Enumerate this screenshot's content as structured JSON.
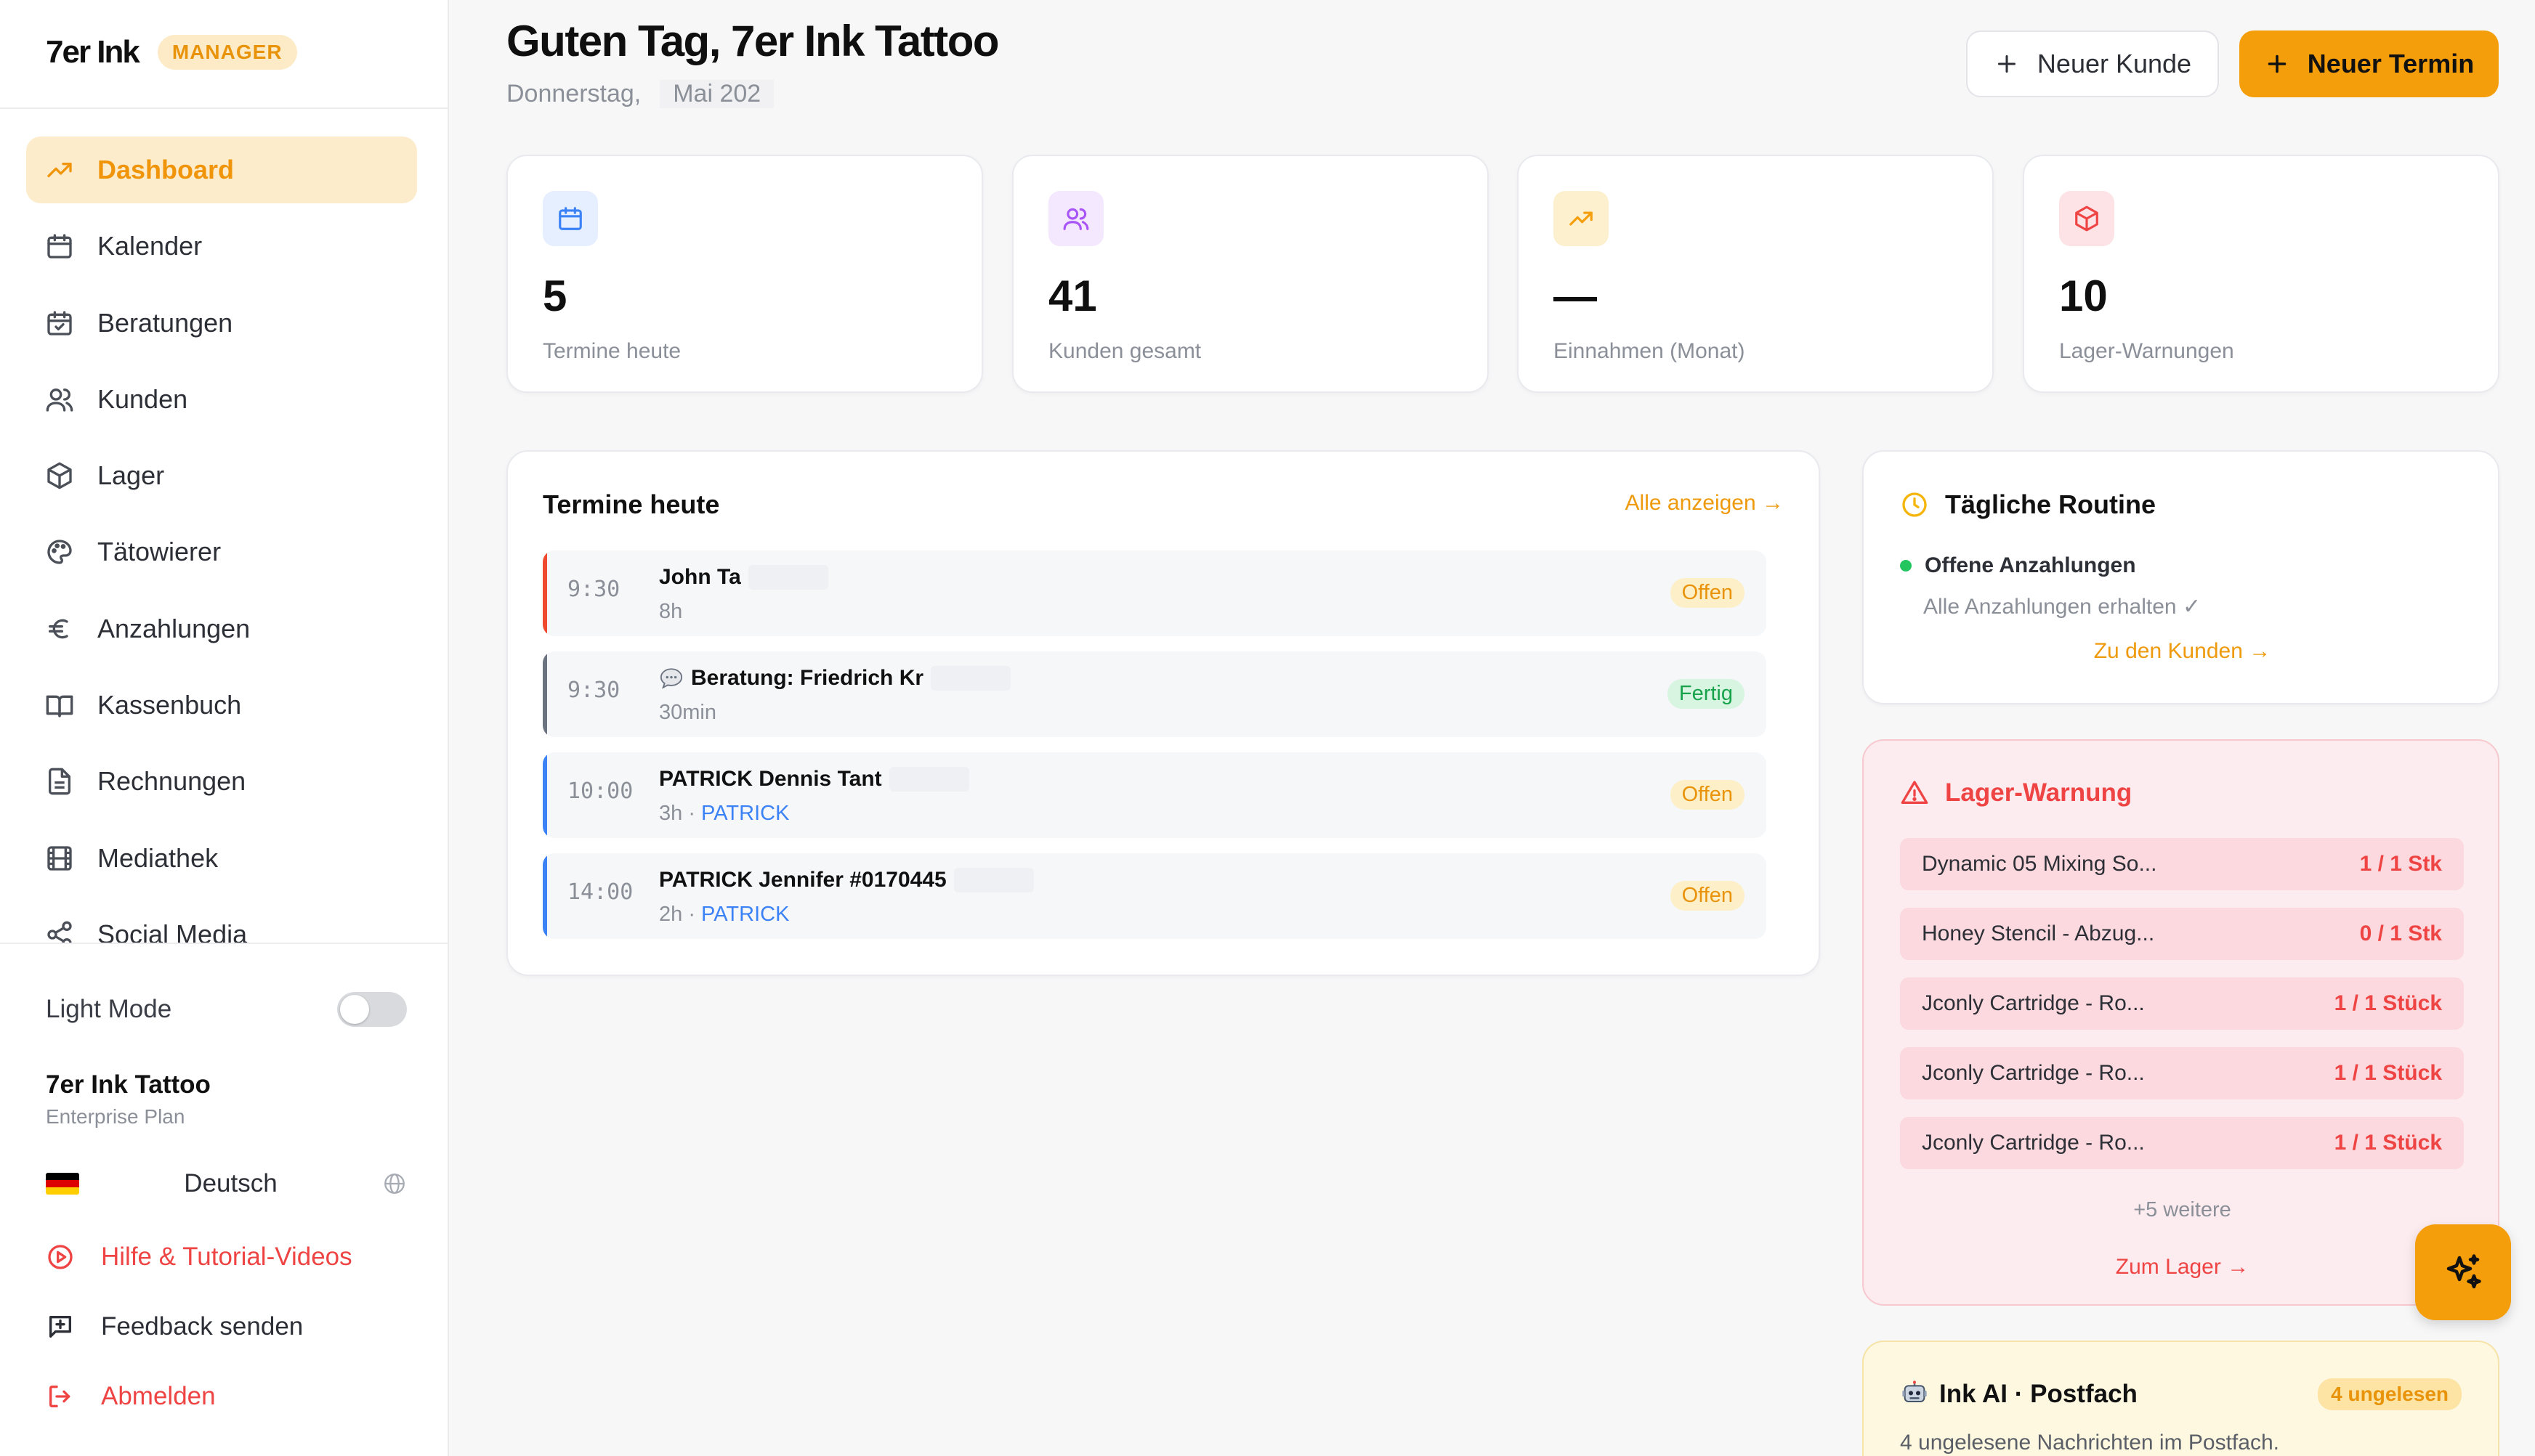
{
  "brand": {
    "name": "7er Ink",
    "role_badge": "MANAGER"
  },
  "sidebar": {
    "items": [
      {
        "label": "Dashboard",
        "icon": "trending-up-icon",
        "active": true
      },
      {
        "label": "Kalender",
        "icon": "calendar-icon"
      },
      {
        "label": "Beratungen",
        "icon": "calendar-check-icon"
      },
      {
        "label": "Kunden",
        "icon": "users-icon"
      },
      {
        "label": "Lager",
        "icon": "package-icon"
      },
      {
        "label": "Tätowierer",
        "icon": "palette-icon"
      },
      {
        "label": "Anzahlungen",
        "icon": "euro-icon"
      },
      {
        "label": "Kassenbuch",
        "icon": "book-icon"
      },
      {
        "label": "Rechnungen",
        "icon": "file-text-icon"
      },
      {
        "label": "Mediathek",
        "icon": "film-icon"
      },
      {
        "label": "Social Media",
        "icon": "share-icon"
      }
    ],
    "light_mode_label": "Light Mode",
    "studio_name": "7er Ink Tattoo",
    "plan": "Enterprise Plan",
    "language": "Deutsch",
    "help_label": "Hilfe & Tutorial-Videos",
    "feedback_label": "Feedback senden",
    "logout_label": "Abmelden"
  },
  "header": {
    "greeting": "Guten Tag, 7er Ink Tattoo",
    "weekday": "Donnerstag,",
    "date_partial": "Mai 202",
    "new_customer_label": "Neuer Kunde",
    "new_appointment_label": "Neuer Termin"
  },
  "stats": [
    {
      "value": "5",
      "label": "Termine heute",
      "icon": "calendar-icon",
      "bg": "#e6efff",
      "fg": "#3b82f6"
    },
    {
      "value": "41",
      "label": "Kunden gesamt",
      "icon": "users-icon",
      "bg": "#f4e8ff",
      "fg": "#a855f7"
    },
    {
      "value": "—",
      "label": "Einnahmen (Monat)",
      "icon": "trending-up-icon",
      "bg": "#fdf0cf",
      "fg": "#f59e0b"
    },
    {
      "value": "10",
      "label": "Lager-Warnungen",
      "icon": "package-icon",
      "bg": "#fde3e6",
      "fg": "#ef4444"
    }
  ],
  "appointments": {
    "title": "Termine heute",
    "view_all": "Alle anzeigen →",
    "items": [
      {
        "time": "9:30",
        "title": "John Ta",
        "duration": "8h",
        "artist": "",
        "status": "Offen",
        "bar": "#ef4a2d"
      },
      {
        "time": "9:30",
        "title": "Beratung: Friedrich Kr",
        "duration": "30min",
        "artist": "",
        "status": "Fertig",
        "bar": "#6b7280"
      },
      {
        "time": "10:00",
        "title": "PATRICK Dennis Tant",
        "duration": "3h",
        "artist": "PATRICK",
        "status": "Offen",
        "bar": "#3b82f6"
      },
      {
        "time": "14:00",
        "title": "PATRICK Jennifer #0170445",
        "duration": "2h",
        "artist": "PATRICK",
        "status": "Offen",
        "bar": "#3b82f6"
      }
    ]
  },
  "routine": {
    "title": "Tägliche Routine",
    "item": "Offene Anzahlungen",
    "item_sub": "Alle Anzahlungen erhalten ✓",
    "link": "Zu den Kunden →"
  },
  "stock_warning": {
    "title": "Lager-Warnung",
    "items": [
      {
        "name": "Dynamic 05 Mixing So...",
        "qty": "1 / 1 Stk"
      },
      {
        "name": "Honey Stencil - Abzug...",
        "qty": "0 / 1 Stk"
      },
      {
        "name": "Jconly Cartridge - Ro...",
        "qty": "1 / 1 Stück"
      },
      {
        "name": "Jconly Cartridge - Ro...",
        "qty": "1 / 1 Stück"
      },
      {
        "name": "Jconly Cartridge - Ro...",
        "qty": "1 / 1 Stück"
      }
    ],
    "more": "+5 weitere",
    "link": "Zum Lager →"
  },
  "ai_inbox": {
    "title": "Ink AI · Postfach",
    "badge": "4 ungelesen",
    "subtitle": "4 ungelesene Nachrichten im Postfach."
  },
  "colors": {
    "accent": "#f59e0b",
    "danger": "#ef4444",
    "success": "#22c55e",
    "info": "#3b82f6"
  }
}
